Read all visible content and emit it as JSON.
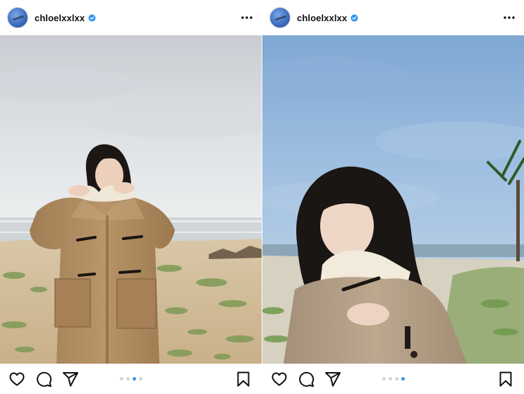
{
  "colors": {
    "accent": "#3897f0",
    "verified": "#3897f0",
    "text": "#111111",
    "inactive_dot": "#d7d7d7"
  },
  "posts": [
    {
      "username": "chloelxxlxx",
      "verified": true,
      "icons": [
        "avatar",
        "verified-badge-icon",
        "more-options-icon",
        "heart-icon",
        "comment-icon",
        "share-icon",
        "bookmark-icon"
      ],
      "carousel": {
        "total": 4,
        "active_index": 2
      }
    },
    {
      "username": "chloelxxlxx",
      "verified": true,
      "icons": [
        "avatar",
        "verified-badge-icon",
        "more-options-icon",
        "heart-icon",
        "comment-icon",
        "share-icon",
        "bookmark-icon"
      ],
      "carousel": {
        "total": 4,
        "active_index": 3
      }
    }
  ]
}
